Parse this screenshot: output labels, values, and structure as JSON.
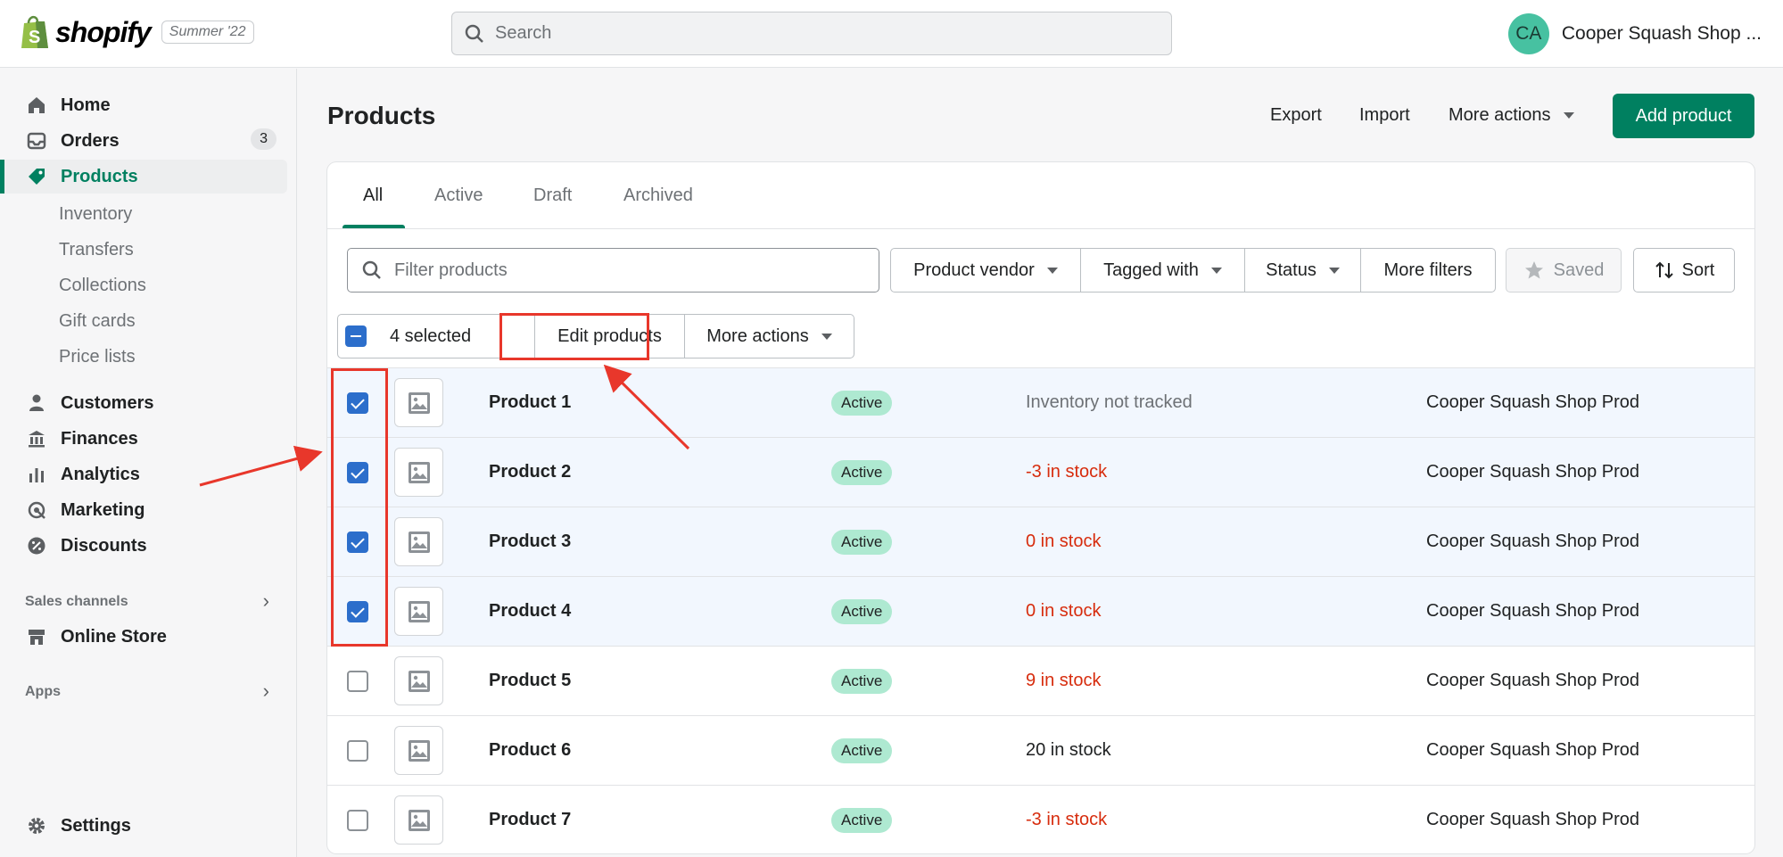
{
  "topbar": {
    "brand": "shopify",
    "edition": "Summer '22",
    "search_placeholder": "Search",
    "avatar_initials": "CA",
    "shop_name": "Cooper Squash Shop ..."
  },
  "sidebar": {
    "items": [
      {
        "label": "Home",
        "icon": "home-icon"
      },
      {
        "label": "Orders",
        "icon": "orders-icon",
        "badge": "3"
      },
      {
        "label": "Products",
        "icon": "tag-icon",
        "active": true
      },
      {
        "label": "Customers",
        "icon": "person-icon"
      },
      {
        "label": "Finances",
        "icon": "bank-icon"
      },
      {
        "label": "Analytics",
        "icon": "bar-chart-icon"
      },
      {
        "label": "Marketing",
        "icon": "target-icon"
      },
      {
        "label": "Discounts",
        "icon": "discount-icon"
      }
    ],
    "product_subitems": [
      "Inventory",
      "Transfers",
      "Collections",
      "Gift cards",
      "Price lists"
    ],
    "sales_channels_title": "Sales channels",
    "online_store": "Online Store",
    "apps_title": "Apps",
    "settings": "Settings"
  },
  "page": {
    "title": "Products",
    "export": "Export",
    "import": "Import",
    "more_actions": "More actions",
    "add_product": "Add product"
  },
  "tabs": [
    "All",
    "Active",
    "Draft",
    "Archived"
  ],
  "filters": {
    "placeholder": "Filter products",
    "vendor": "Product vendor",
    "tagged": "Tagged with",
    "status": "Status",
    "more": "More filters",
    "saved": "Saved",
    "sort": "Sort"
  },
  "bulk": {
    "selected": "4 selected",
    "edit": "Edit products",
    "more": "More actions"
  },
  "products": [
    {
      "name": "Product 1",
      "status": "Active",
      "inventory": "Inventory not tracked",
      "inv_color": "#6d7175",
      "vendor": "Cooper Squash Shop Prod",
      "checked": true
    },
    {
      "name": "Product 2",
      "status": "Active",
      "inventory": "-3 in stock",
      "inv_color": "#d72c0d",
      "vendor": "Cooper Squash Shop Prod",
      "checked": true
    },
    {
      "name": "Product 3",
      "status": "Active",
      "inventory": "0 in stock",
      "inv_color": "#d72c0d",
      "vendor": "Cooper Squash Shop Prod",
      "checked": true
    },
    {
      "name": "Product 4",
      "status": "Active",
      "inventory": "0 in stock",
      "inv_color": "#d72c0d",
      "vendor": "Cooper Squash Shop Prod",
      "checked": true
    },
    {
      "name": "Product 5",
      "status": "Active",
      "inventory": "9 in stock",
      "inv_color": "#d72c0d",
      "vendor": "Cooper Squash Shop Prod",
      "checked": false
    },
    {
      "name": "Product 6",
      "status": "Active",
      "inventory": "20 in stock",
      "inv_color": "#202223",
      "vendor": "Cooper Squash Shop Prod",
      "checked": false
    },
    {
      "name": "Product 7",
      "status": "Active",
      "inventory": "-3 in stock",
      "inv_color": "#d72c0d",
      "vendor": "Cooper Squash Shop Prod",
      "checked": false
    }
  ],
  "colors": {
    "accent": "#008060",
    "selection": "#2c6ecb",
    "annotation": "#e8372b"
  }
}
